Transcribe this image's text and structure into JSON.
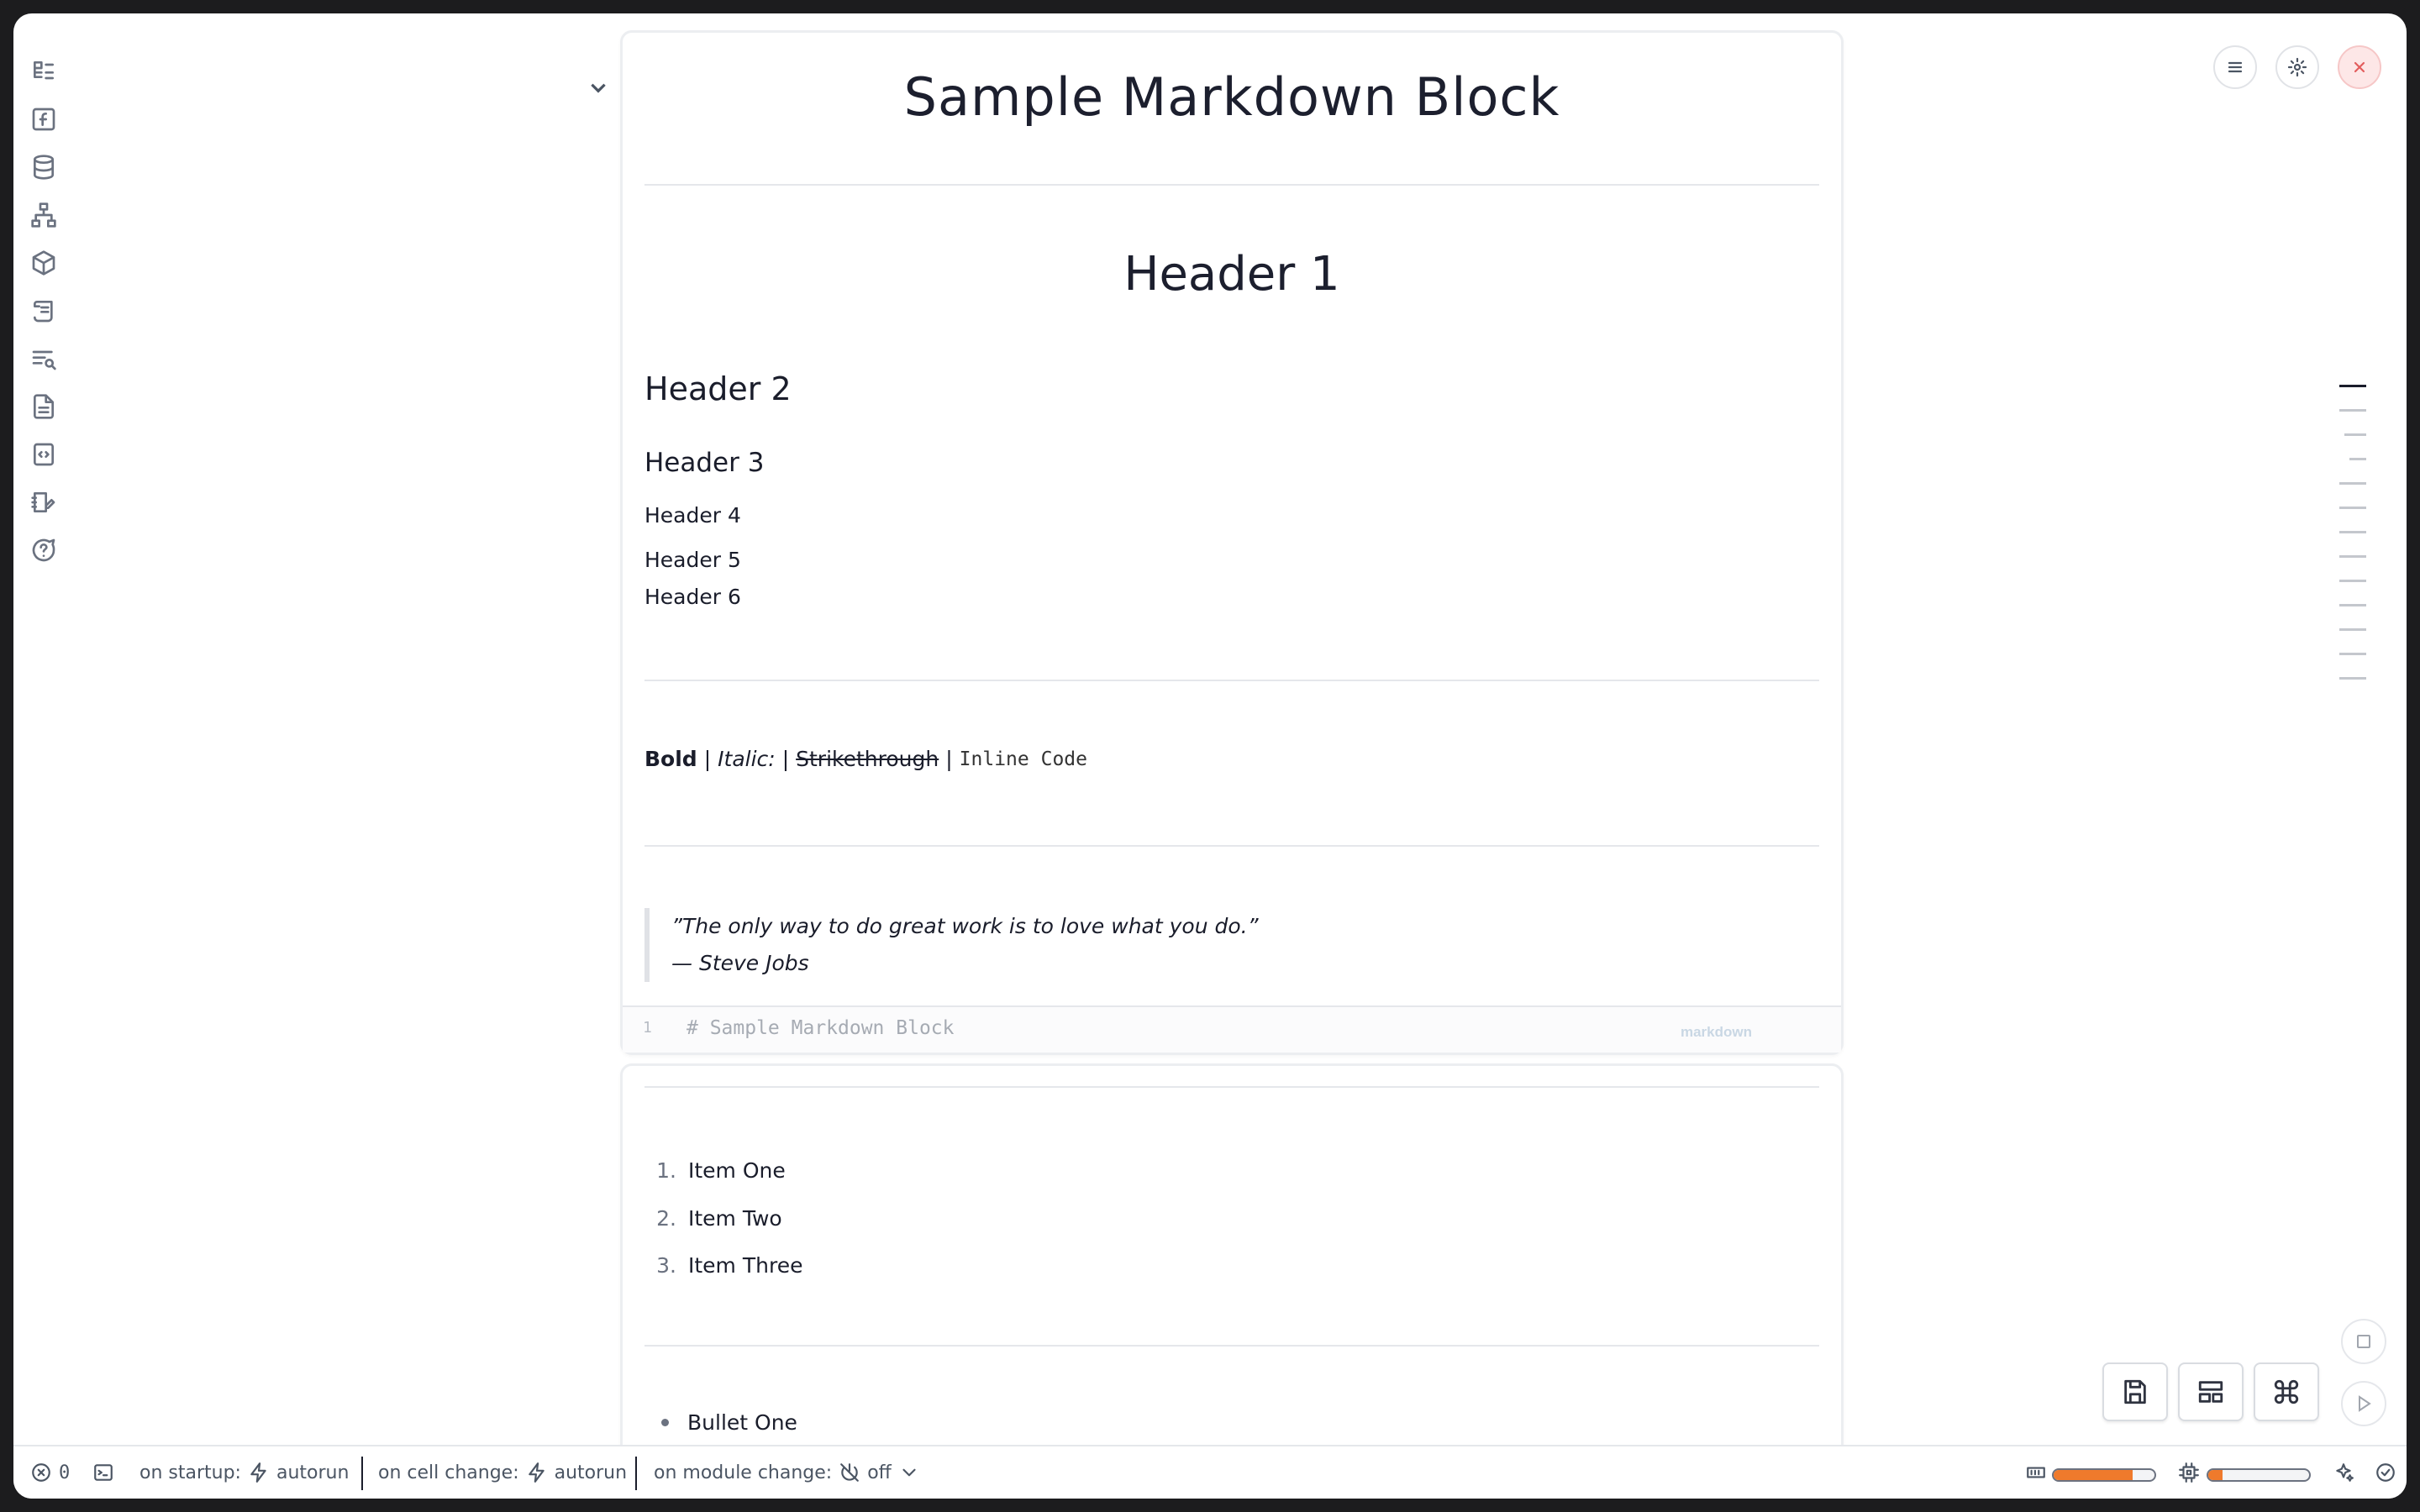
{
  "rail": {
    "icons": [
      "file-tree-icon",
      "function-icon",
      "database-icon",
      "dependency-graph-icon",
      "package-icon",
      "scroll-icon",
      "search-list-icon",
      "document-icon",
      "code-file-icon",
      "notebook-edit-icon",
      "help-icon"
    ]
  },
  "cell1": {
    "title": "Sample Markdown Block",
    "h1": "Header 1",
    "h2": "Header 2",
    "h3": "Header 3",
    "h4": "Header 4",
    "h5": "Header 5",
    "h6": "Header 6",
    "bold": "Bold",
    "italic": "Italic:",
    "strike": "Strikethrough",
    "code": "Inline Code",
    "separator": "|",
    "quote_line1": "”The only way to do great work is to love what you do.”",
    "quote_line2": "— Steve Jobs",
    "editor": {
      "line_number": "1",
      "code": "# Sample Markdown Block",
      "language": "markdown"
    }
  },
  "cell2": {
    "ordered": [
      {
        "num": "1.",
        "text": "Item One"
      },
      {
        "num": "2.",
        "text": "Item Two"
      },
      {
        "num": "3.",
        "text": "Item Three"
      }
    ],
    "bullets": [
      "Bullet One"
    ]
  },
  "status": {
    "error_count": "0",
    "startup_label": "on startup:",
    "startup_value": "autorun",
    "cell_change_label": "on cell change:",
    "cell_change_value": "autorun",
    "module_change_label": "on module change:",
    "module_change_value": "off",
    "memory_fraction": 0.78,
    "cpu_fraction": 0.14
  },
  "colors": {
    "accent_orange": "#ef7a2c",
    "close_red": "#e35d5d"
  }
}
